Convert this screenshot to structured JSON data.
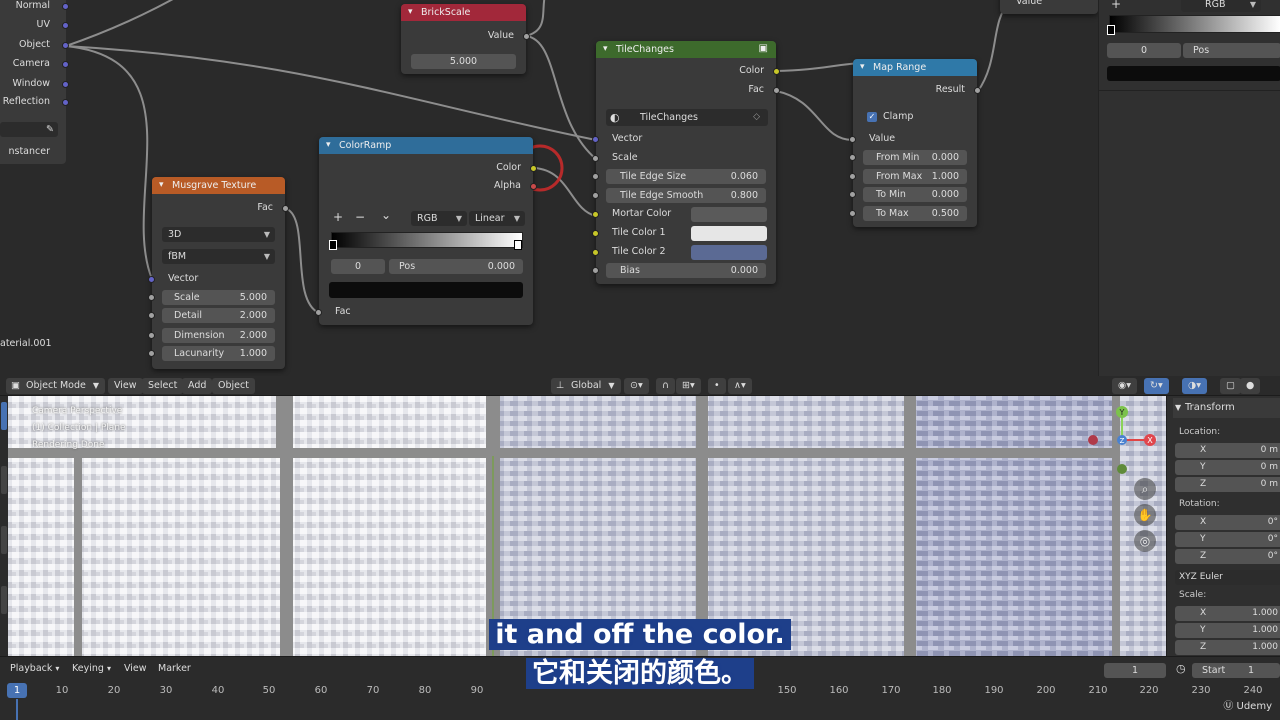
{
  "left_panel": {
    "items": [
      "Normal",
      "UV",
      "Object",
      "Camera",
      "Window",
      "Reflection"
    ],
    "instancer": "nstancer",
    "material_name": "aterial.001"
  },
  "brickscale": {
    "title": "BrickScale",
    "output": "Value",
    "value": "5.000"
  },
  "colorramp": {
    "title": "ColorRamp",
    "outputs": [
      "Color",
      "Alpha"
    ],
    "controls": {
      "add": "+",
      "remove": "−",
      "menu": "⌄",
      "mode": "RGB",
      "interp": "Linear"
    },
    "stop_index": "0",
    "pos_label": "Pos",
    "pos_value": "0.000",
    "input": "Fac"
  },
  "musgrave": {
    "title": "Musgrave Texture",
    "output": "Fac",
    "dimension_mode": "3D",
    "type": "fBM",
    "vector": "Vector",
    "fields": [
      {
        "label": "Scale",
        "value": "5.000"
      },
      {
        "label": "Detail",
        "value": "2.000"
      },
      {
        "label": "Dimension",
        "value": "2.000"
      },
      {
        "label": "Lacunarity",
        "value": "1.000"
      }
    ]
  },
  "tilechanges": {
    "title": "TileChanges",
    "outputs": [
      "Color",
      "Fac"
    ],
    "group_name": "TileChanges",
    "vector": "Vector",
    "scale": "Scale",
    "fields": [
      {
        "label": "Tile Edge Size",
        "value": "0.060"
      },
      {
        "label": "Tile Edge Smooth",
        "value": "0.800"
      }
    ],
    "color_inputs": [
      "Mortar Color",
      "Tile Color 1",
      "Tile Color 2"
    ],
    "bias_label": "Bias",
    "bias_value": "0.000",
    "colors": {
      "mortar": "#5a5a5a",
      "tile1": "#e6e6e6",
      "tile2": "#5b6a94"
    }
  },
  "maprange": {
    "title": "Map Range",
    "output": "Result",
    "clamp": "Clamp",
    "value": "Value",
    "fields": [
      {
        "label": "From Min",
        "value": "0.000"
      },
      {
        "label": "From Max",
        "value": "1.000"
      },
      {
        "label": "To Min",
        "value": "0.000"
      },
      {
        "label": "To Max",
        "value": "0.500"
      }
    ]
  },
  "top_right": {
    "value_label": "Value",
    "mode": "RGB",
    "stop_index": "0",
    "pos_label": "Pos"
  },
  "viewport": {
    "header": {
      "mode": "Object Mode",
      "menus": [
        "View",
        "Select",
        "Add",
        "Object"
      ],
      "transform_orientation": "Global"
    },
    "overlay": [
      "Camera Perspective",
      "(1) Collection | Plane",
      "Rendering Done"
    ],
    "gizmo": {
      "y": "Y",
      "z": "Z",
      "x": "X"
    },
    "sidebar": {
      "title": "Transform",
      "location": "Location:",
      "location_fields": [
        {
          "axis": "X",
          "value": "0 m"
        },
        {
          "axis": "Y",
          "value": "0 m"
        },
        {
          "axis": "Z",
          "value": "0 m"
        }
      ],
      "rotation": "Rotation:",
      "rotation_fields": [
        {
          "axis": "X",
          "value": "0°"
        },
        {
          "axis": "Y",
          "value": "0°"
        },
        {
          "axis": "Z",
          "value": "0°"
        }
      ],
      "rotation_mode": "XYZ Euler",
      "scale": "Scale:",
      "scale_fields": [
        {
          "axis": "X",
          "value": "1.000"
        },
        {
          "axis": "Y",
          "value": "1.000"
        },
        {
          "axis": "Z",
          "value": "1.000"
        }
      ]
    }
  },
  "timeline": {
    "menus": [
      "Playback",
      "Keying",
      "View",
      "Marker"
    ],
    "current_frame_field": "1",
    "start_label": "Start",
    "start_value": "1",
    "current_frame": "1",
    "ticks": [
      "10",
      "20",
      "30",
      "40",
      "50",
      "60",
      "70",
      "80",
      "90",
      "150",
      "160",
      "170",
      "180",
      "190",
      "200",
      "210",
      "220",
      "230",
      "240"
    ]
  },
  "subtitles": {
    "en": "it and off the color.",
    "cn": "它和关闭的颜色。"
  },
  "watermark": "Udemy"
}
